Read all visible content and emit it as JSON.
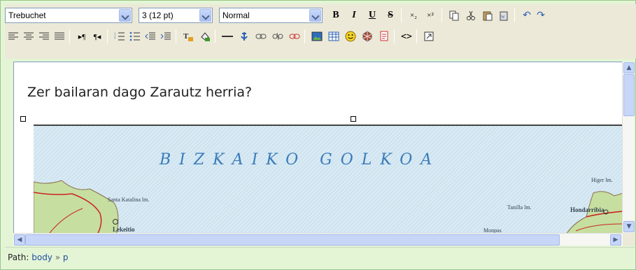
{
  "toolbar": {
    "font_family": "Trebuchet",
    "font_size": "3 (12 pt)",
    "paragraph_format": "Normal",
    "bold": "B",
    "italic": "I",
    "underline": "U",
    "strikethrough": "S",
    "subscript": "×₂",
    "superscript": "×²"
  },
  "editor": {
    "question": "Zer bailaran dago Zarautz herria?",
    "map": {
      "title": "BIZKAIKO GOLKOA",
      "labels": {
        "santa_katalina": "Santa Katalina lm.",
        "lekeitio": "Lekeitio",
        "tanilla": "Tanilla lm.",
        "monpas": "Monpas",
        "higer": "Higer lm.",
        "hondarribia": "Hondarribia"
      },
      "colors": {
        "sea": "#d4e7f2",
        "land": "#c6dfa0",
        "road": "#cc2222"
      }
    }
  },
  "status": {
    "path_label": "Path:",
    "crumb_body": "body",
    "crumb_sep": "»",
    "crumb_p": "p"
  }
}
